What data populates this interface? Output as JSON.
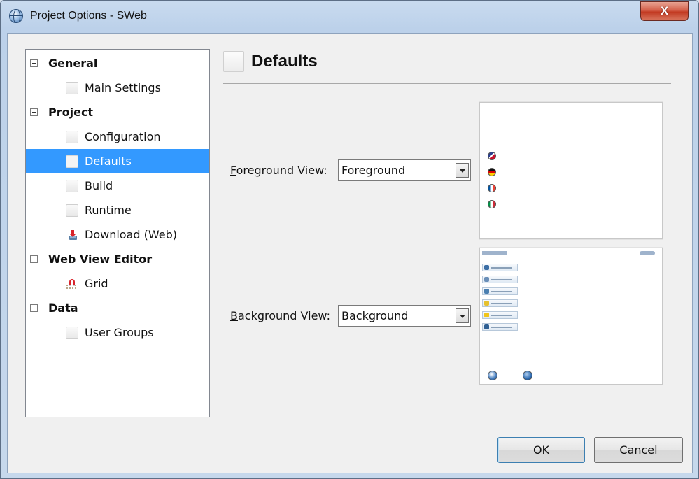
{
  "window": {
    "title": "Project Options - SWeb",
    "close_label": "X"
  },
  "tree": {
    "categories": [
      {
        "label": "General",
        "items": [
          {
            "label": "Main Settings"
          }
        ]
      },
      {
        "label": "Project",
        "items": [
          {
            "label": "Configuration"
          },
          {
            "label": "Defaults",
            "selected": true
          },
          {
            "label": "Build"
          },
          {
            "label": "Runtime"
          },
          {
            "label": "Download (Web)",
            "icon": "download-icon"
          }
        ]
      },
      {
        "label": "Web View Editor",
        "items": [
          {
            "label": "Grid",
            "icon": "magnet-grid-icon"
          }
        ]
      },
      {
        "label": "Data",
        "items": [
          {
            "label": "User Groups"
          }
        ]
      }
    ]
  },
  "panel": {
    "title": "Defaults",
    "foreground": {
      "label_mnemonic": "F",
      "label_rest": "oreground View:",
      "value": "Foreground"
    },
    "background": {
      "label_mnemonic": "B",
      "label_rest": "ackground View:",
      "value": "Background"
    }
  },
  "buttons": {
    "ok": {
      "mnemonic": "O",
      "rest": "K"
    },
    "cancel": {
      "mnemonic": "C",
      "rest": "ancel"
    }
  },
  "colors": {
    "selection": "#3399ff",
    "accent": "#3c7fb1"
  }
}
